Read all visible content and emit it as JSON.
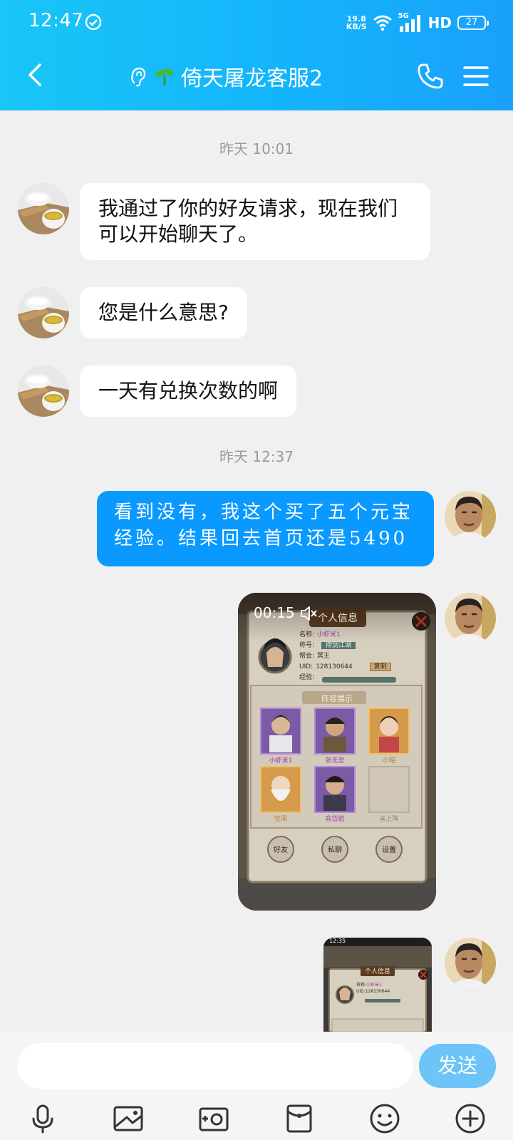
{
  "status_bar": {
    "time": "12:47",
    "net_speed_value": "19.8",
    "net_speed_unit": "KB/S",
    "network": "5G",
    "hd": "HD",
    "battery": "27"
  },
  "header": {
    "title": "倚天屠龙客服2"
  },
  "messages": {
    "time1": "昨天 10:01",
    "msg1": "我通过了你的好友请求，现在我们可以开始聊天了。",
    "msg2": "您是什么意思?",
    "msg3": "一天有兑换次数的啊",
    "time2": "昨天 12:37",
    "msg4": "看到没有，我这个买了五个元宝经验。结果回去首页还是5490"
  },
  "video": {
    "duration": "00:15",
    "panel_title": "个人信息",
    "name_label": "名称:",
    "name_value": "小虾米1",
    "nick_label": "称号:",
    "nick_value": "捞剑江湖",
    "guild_label": "帮会:",
    "guild_value": "冥王",
    "uid_label": "UID:",
    "uid_value": "128130644",
    "copy_label": "复制",
    "exp_label": "经验:",
    "lineup_title": "阵容展示",
    "heroes": [
      "小虾米1",
      "张无忌",
      "小昭",
      "空闻",
      "俞岱岩",
      "未上阵"
    ],
    "buttons": [
      "好友",
      "私聊",
      "设置"
    ]
  },
  "image_preview": {
    "time": "12:35",
    "panel_title": "个人信息",
    "name_label": "名称:",
    "name_value": "小虾米1",
    "uid_label": "UID:",
    "uid_value": "128130644"
  },
  "input": {
    "placeholder": "",
    "send_label": "发送"
  },
  "colors": {
    "header_start": "#19c6f6",
    "header_end": "#1aa1fb",
    "outgoing_bubble": "#0a99ff",
    "send_button": "#6cc4f8",
    "background": "#f0f0f0"
  }
}
